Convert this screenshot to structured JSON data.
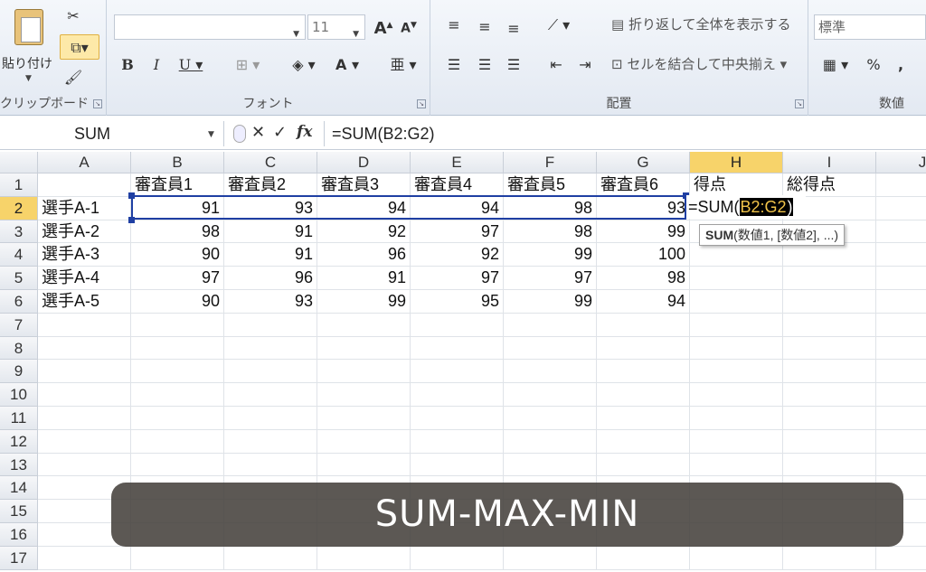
{
  "ribbon": {
    "clipboard": {
      "label": "クリップボード",
      "paste": "貼り付け"
    },
    "font": {
      "label": "フォント",
      "font_size": "11"
    },
    "alignment": {
      "label": "配置",
      "wrap_text": "折り返して全体を表示する",
      "merge_center": "セルを結合して中央揃え"
    },
    "number": {
      "label": "数値",
      "format": "標準",
      "percent": "%",
      "comma": ","
    }
  },
  "formula_bar": {
    "name_box": "SUM",
    "formula": "=SUM(B2:G2)",
    "fx": "fx"
  },
  "sheet": {
    "columns": [
      "A",
      "B",
      "C",
      "D",
      "E",
      "F",
      "G",
      "H",
      "I",
      "J"
    ],
    "rows": [
      "1",
      "2",
      "3",
      "4",
      "5",
      "6",
      "7",
      "8",
      "9",
      "10",
      "11",
      "12",
      "13",
      "14",
      "15",
      "16",
      "17"
    ],
    "headers_row": [
      "",
      "審査員1",
      "審査員2",
      "審査員3",
      "審査員4",
      "審査員5",
      "審査員6",
      "得点",
      "総得点"
    ],
    "players": [
      {
        "name": "選手A-1",
        "scores": [
          91,
          93,
          94,
          94,
          98,
          93
        ]
      },
      {
        "name": "選手A-2",
        "scores": [
          98,
          91,
          92,
          97,
          98,
          99
        ]
      },
      {
        "name": "選手A-3",
        "scores": [
          90,
          91,
          96,
          92,
          99,
          100
        ]
      },
      {
        "name": "選手A-4",
        "scores": [
          97,
          96,
          91,
          97,
          97,
          98
        ]
      },
      {
        "name": "選手A-5",
        "scores": [
          90,
          93,
          99,
          95,
          99,
          94
        ]
      }
    ],
    "edit": {
      "prefix": "=SUM(",
      "ref": "B2:G2",
      "suffix": ")"
    },
    "tooltip": {
      "fn": "SUM",
      "args": "(数値1, [数値2], ...)"
    }
  },
  "banner": "SUM-MAX-MIN"
}
